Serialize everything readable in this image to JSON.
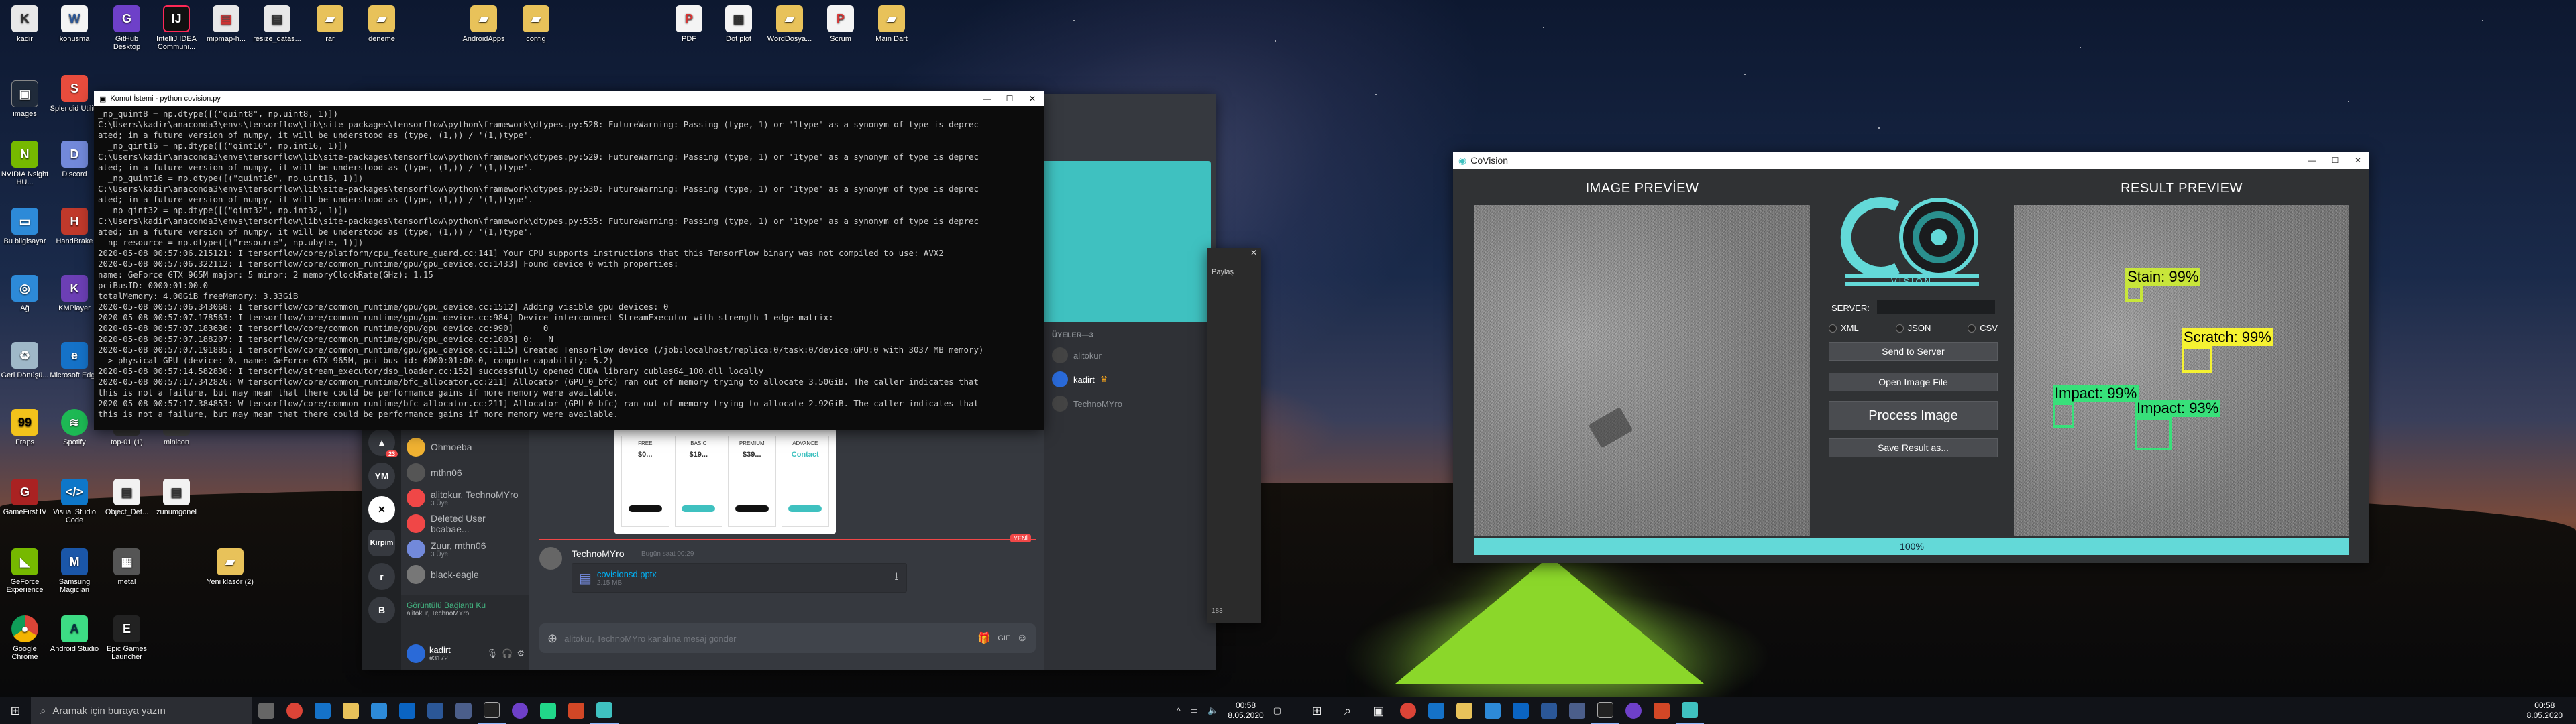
{
  "desktop": {
    "icons_row1": [
      "kadir",
      "konusma",
      "GitHub Desktop",
      "IntelliJ IDEA Communi...",
      "mipmap-h...",
      "resize_datas...",
      "rar",
      "deneme",
      "AndroidApps",
      "config",
      "PDF",
      "Dot plot",
      "WordDosya...",
      "Scrum",
      "Main Dart"
    ],
    "icons_col": [
      "images",
      "Splendid Utility",
      "NVIDIA Nsight HU...",
      "Discord",
      "Bu bilgisayar",
      "HandBrake",
      "Ağ",
      "KMPlayer",
      "Geri Dönüşü...",
      "Microsoft Edge",
      "Fraps",
      "Spotify",
      "top-01 (1)",
      "minicon",
      "GameFirst IV",
      "Visual Studio Code",
      "Object_Det...",
      "zunumgonel",
      "GeForce Experience",
      "Samsung Magician",
      "metal",
      "Yeni klasör (2)",
      "Google Chrome",
      "Android Studio",
      "Epic Games Launcher"
    ]
  },
  "terminal": {
    "title": "Komut İstemi - python covision.py",
    "lines": [
      "_np_quint8 = np.dtype([(\"quint8\", np.uint8, 1)])",
      "C:\\Users\\kadir\\anaconda3\\envs\\tensorflow\\lib\\site-packages\\tensorflow\\python\\framework\\dtypes.py:528: FutureWarning: Passing (type, 1) or '1type' as a synonym of type is deprec",
      "ated; in a future version of numpy, it will be understood as (type, (1,)) / '(1,)type'.",
      "  _np_qint16 = np.dtype([(\"qint16\", np.int16, 1)])",
      "C:\\Users\\kadir\\anaconda3\\envs\\tensorflow\\lib\\site-packages\\tensorflow\\python\\framework\\dtypes.py:529: FutureWarning: Passing (type, 1) or '1type' as a synonym of type is deprec",
      "ated; in a future version of numpy, it will be understood as (type, (1,)) / '(1,)type'.",
      "  _np_quint16 = np.dtype([(\"quint16\", np.uint16, 1)])",
      "C:\\Users\\kadir\\anaconda3\\envs\\tensorflow\\lib\\site-packages\\tensorflow\\python\\framework\\dtypes.py:530: FutureWarning: Passing (type, 1) or '1type' as a synonym of type is deprec",
      "ated; in a future version of numpy, it will be understood as (type, (1,)) / '(1,)type'.",
      "  _np_qint32 = np.dtype([(\"qint32\", np.int32, 1)])",
      "C:\\Users\\kadir\\anaconda3\\envs\\tensorflow\\lib\\site-packages\\tensorflow\\python\\framework\\dtypes.py:535: FutureWarning: Passing (type, 1) or '1type' as a synonym of type is deprec",
      "ated; in a future version of numpy, it will be understood as (type, (1,)) / '(1,)type'.",
      "  np_resource = np.dtype([(\"resource\", np.ubyte, 1)])",
      "2020-05-08 00:57:06.215121: I tensorflow/core/platform/cpu_feature_guard.cc:141] Your CPU supports instructions that this TensorFlow binary was not compiled to use: AVX2",
      "2020-05-08 00:57:06.322112: I tensorflow/core/common_runtime/gpu/gpu_device.cc:1433] Found device 0 with properties:",
      "name: GeForce GTX 965M major: 5 minor: 2 memoryClockRate(GHz): 1.15",
      "pciBusID: 0000:01:00.0",
      "totalMemory: 4.00GiB freeMemory: 3.33GiB",
      "2020-05-08 00:57:06.343068: I tensorflow/core/common_runtime/gpu/gpu_device.cc:1512] Adding visible gpu devices: 0",
      "2020-05-08 00:57:07.178563: I tensorflow/core/common_runtime/gpu/gpu_device.cc:984] Device interconnect StreamExecutor with strength 1 edge matrix:",
      "2020-05-08 00:57:07.183636: I tensorflow/core/common_runtime/gpu/gpu_device.cc:990]      0",
      "2020-05-08 00:57:07.188207: I tensorflow/core/common_runtime/gpu/gpu_device.cc:1003] 0:   N",
      "2020-05-08 00:57:07.191885: I tensorflow/core/common_runtime/gpu/gpu_device.cc:1115] Created TensorFlow device (/job:localhost/replica:0/task:0/device:GPU:0 with 3037 MB memory)",
      " -> physical GPU (device: 0, name: GeForce GTX 965M, pci bus id: 0000:01:00.0, compute capability: 5.2)",
      "2020-05-08 00:57:14.582830: I tensorflow/stream_executor/dso_loader.cc:152] successfully opened CUDA library cublas64_100.dll locally",
      "2020-05-08 00:57:17.342826: W tensorflow/core/common_runtime/bfc_allocator.cc:211] Allocator (GPU_0_bfc) ran out of memory trying to allocate 3.50GiB. The caller indicates that",
      "this is not a failure, but may mean that there could be performance gains if more memory were available.",
      "2020-05-08 00:57:17.384853: W tensorflow/core/common_runtime/bfc_allocator.cc:211] Allocator (GPU_0_bfc) ran out of memory trying to allocate 2.92GiB. The caller indicates that",
      "this is not a failure, but may mean that there could be performance gains if more memory were available."
    ]
  },
  "discord": {
    "dms": [
      {
        "name": "Ohmoeba",
        "sub": ""
      },
      {
        "name": "mthn06",
        "sub": ""
      },
      {
        "name": "alitokur, TechnoMYro",
        "sub": "3 Üye"
      },
      {
        "name": "Deleted User bcabae...",
        "sub": ""
      },
      {
        "name": "Zuur, mthn06",
        "sub": "3 Üye"
      },
      {
        "name": "black-eagle",
        "sub": ""
      }
    ],
    "voice_status": "Görüntülü Bağlantı Ku",
    "voice_sub": "alitokur, TechnoMYro",
    "user": "kadirt",
    "user_tag": "#3172",
    "guild_badge_1": "23",
    "guild_label": "YM",
    "guild_label_2": "Kirpim",
    "message_author": "TechnoMYro",
    "message_time": "Bugün saat 00:29",
    "attachment_name": "covisionsd.pptx",
    "attachment_size": "2.15 MB",
    "new_badge": "YENİ",
    "input_placeholder": "alitokur, TechnoMYro kanalına mesaj gönder",
    "members_header": "ÜYELER—3",
    "members": [
      "alitokur",
      "kadirt",
      "TechnoMYro"
    ],
    "pricing_titles": [
      "FREE",
      "BASIC",
      "PREMIUM",
      "ADVANCE"
    ],
    "pricing_prices": [
      "$0...",
      "$19...",
      "$39...",
      "Contact"
    ],
    "share_label": "Paylaş",
    "side_number": "183"
  },
  "covision": {
    "title": "CoVision",
    "image_preview_label": "IMAGE PREVİEW",
    "result_preview_label": "RESULT PREVIEW",
    "logo_text": "VISION",
    "server_label": "SERVER:",
    "server_value": "",
    "format_options": [
      "XML",
      "JSON",
      "CSV"
    ],
    "buttons": {
      "send": "Send to Server",
      "open": "Open Image File",
      "process": "Process Image",
      "save": "Save Result as..."
    },
    "progress_text": "100%",
    "progress_value": 1.0,
    "detections": [
      {
        "label": "Stain: 99%",
        "color": "#c8e63a"
      },
      {
        "label": "Scratch: 99%",
        "color": "#f5f232"
      },
      {
        "label": "Impact: 99%",
        "color": "#38e07a"
      },
      {
        "label": "Impact: 93%",
        "color": "#38e07a"
      }
    ],
    "accent": "#63d9d8"
  },
  "taskbar_left": {
    "search_placeholder": "Aramak için buraya yazın",
    "time": "00:58",
    "date": "8.05.2020"
  },
  "taskbar_right": {
    "time": "00:58",
    "date": "8.05.2020"
  }
}
